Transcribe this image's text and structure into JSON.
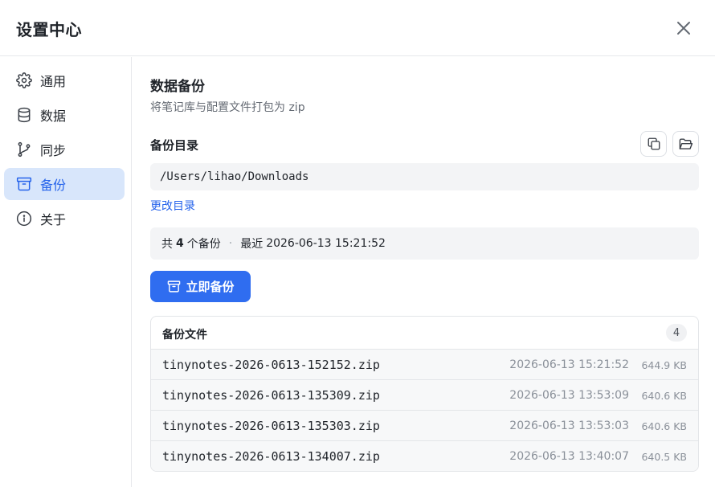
{
  "window": {
    "title": "设置中心"
  },
  "sidebar": {
    "items": [
      {
        "label": "通用",
        "icon": "gear-icon"
      },
      {
        "label": "数据",
        "icon": "database-icon"
      },
      {
        "label": "同步",
        "icon": "git-branch-icon"
      },
      {
        "label": "备份",
        "icon": "archive-icon",
        "active": true
      },
      {
        "label": "关于",
        "icon": "info-icon"
      }
    ]
  },
  "main": {
    "title": "数据备份",
    "subtitle": "将笔记库与配置文件打包为 zip",
    "dir_label": "备份目录",
    "path": "/Users/lihao/Downloads",
    "change_dir": "更改目录",
    "summary": {
      "prefix": "共",
      "count": "4",
      "suffix": "个备份",
      "separator": "·",
      "latest_label": "最近",
      "latest_time": "2026-06-13 15:21:52"
    },
    "backup_button": "立即备份",
    "files": {
      "title": "备份文件",
      "count": "4",
      "rows": [
        {
          "name": "tinynotes-2026-0613-152152.zip",
          "time": "2026-06-13 15:21:52",
          "size": "644.9 KB"
        },
        {
          "name": "tinynotes-2026-0613-135309.zip",
          "time": "2026-06-13 13:53:09",
          "size": "640.6 KB"
        },
        {
          "name": "tinynotes-2026-0613-135303.zip",
          "time": "2026-06-13 13:53:03",
          "size": "640.6 KB"
        },
        {
          "name": "tinynotes-2026-0613-134007.zip",
          "time": "2026-06-13 13:40:07",
          "size": "640.5 KB"
        }
      ]
    }
  },
  "colors": {
    "accent": "#2f6df0",
    "active_bg": "#d8e6fb",
    "active_text": "#2563eb"
  }
}
